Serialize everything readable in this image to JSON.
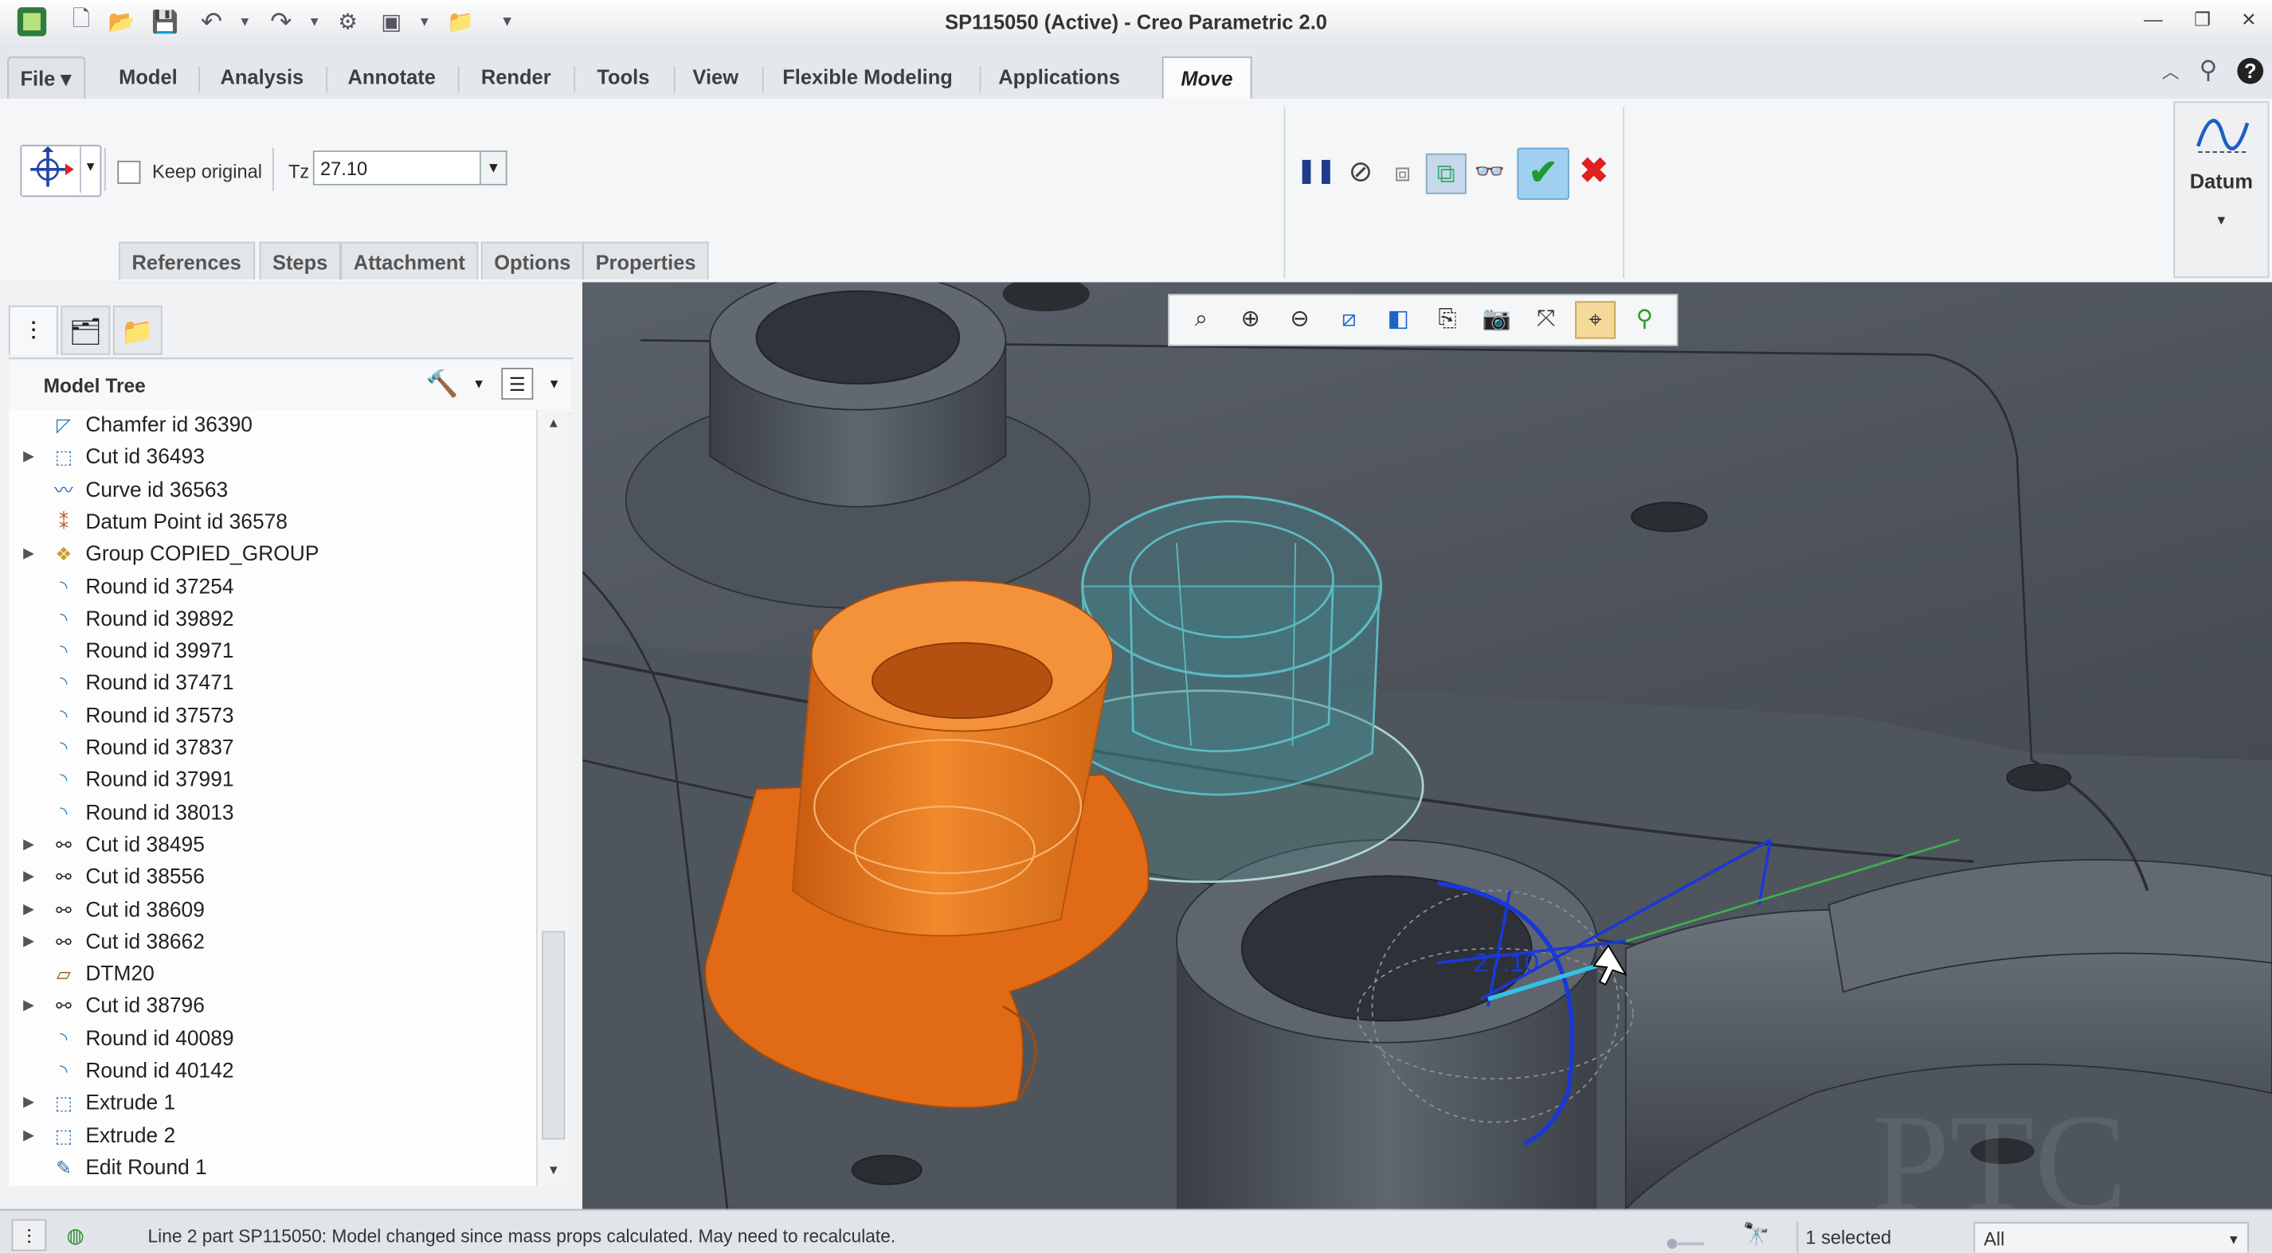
{
  "window": {
    "title": "SP115050 (Active) - Creo Parametric 2.0"
  },
  "ribbon_tabs": [
    {
      "label": "File ▾"
    },
    {
      "label": "Model"
    },
    {
      "label": "Analysis"
    },
    {
      "label": "Annotate"
    },
    {
      "label": "Render"
    },
    {
      "label": "Tools"
    },
    {
      "label": "View"
    },
    {
      "label": "Flexible Modeling"
    },
    {
      "label": "Applications"
    },
    {
      "label": "Move"
    }
  ],
  "move_dashboard": {
    "keep_original_label": "Keep original",
    "keep_original_checked": false,
    "tz_label": "Tz",
    "tz_value": "27.10",
    "subtabs": [
      "References",
      "Steps",
      "Attachment",
      "Options",
      "Properties"
    ],
    "datum_label": "Datum"
  },
  "model_tree": {
    "header": "Model Tree",
    "items": [
      {
        "label": "Chamfer id 36390",
        "icon": "chamfer-icon",
        "expandable": false
      },
      {
        "label": "Cut id 36493",
        "icon": "cut-icon",
        "expandable": true
      },
      {
        "label": "Curve id 36563",
        "icon": "curve-icon",
        "expandable": false
      },
      {
        "label": "Datum Point id 36578",
        "icon": "datum-point-icon",
        "expandable": false
      },
      {
        "label": "Group COPIED_GROUP",
        "icon": "group-icon",
        "expandable": true
      },
      {
        "label": "Round id 37254",
        "icon": "round-icon",
        "expandable": false
      },
      {
        "label": "Round id 39892",
        "icon": "round-icon",
        "expandable": false
      },
      {
        "label": "Round id 39971",
        "icon": "round-icon",
        "expandable": false
      },
      {
        "label": "Round id 37471",
        "icon": "round-icon",
        "expandable": false
      },
      {
        "label": "Round id 37573",
        "icon": "round-icon",
        "expandable": false
      },
      {
        "label": "Round id 37837",
        "icon": "round-icon",
        "expandable": false
      },
      {
        "label": "Round id 37991",
        "icon": "round-icon",
        "expandable": false
      },
      {
        "label": "Round id 38013",
        "icon": "round-icon",
        "expandable": false
      },
      {
        "label": "Cut id 38495",
        "icon": "pattern-cut-icon",
        "expandable": true
      },
      {
        "label": "Cut id 38556",
        "icon": "pattern-cut-icon",
        "expandable": true
      },
      {
        "label": "Cut id 38609",
        "icon": "pattern-cut-icon",
        "expandable": true
      },
      {
        "label": "Cut id 38662",
        "icon": "pattern-cut-icon",
        "expandable": true
      },
      {
        "label": "DTM20",
        "icon": "datum-plane-icon",
        "expandable": false
      },
      {
        "label": "Cut id 38796",
        "icon": "pattern-cut-icon",
        "expandable": true
      },
      {
        "label": "Round id 40089",
        "icon": "round-icon",
        "expandable": false
      },
      {
        "label": "Round id 40142",
        "icon": "round-icon",
        "expandable": false
      },
      {
        "label": "Extrude 1",
        "icon": "extrude-icon",
        "expandable": true
      },
      {
        "label": "Extrude 2",
        "icon": "extrude-icon",
        "expandable": true
      },
      {
        "label": "Edit Round 1",
        "icon": "edit-round-icon",
        "expandable": false
      }
    ]
  },
  "viewport": {
    "dimension_label": "27.10",
    "watermark": "PTC"
  },
  "status_bar": {
    "message": "Line 2 part SP115050: Model changed since mass props calculated. May need to recalculate.",
    "selection": "1 selected",
    "filter": "All"
  },
  "colors": {
    "moved_body": "#e8781e",
    "copy_preview": "#5ad0d8",
    "model": "#5b646d",
    "drag_handle": "#1a38d8"
  }
}
